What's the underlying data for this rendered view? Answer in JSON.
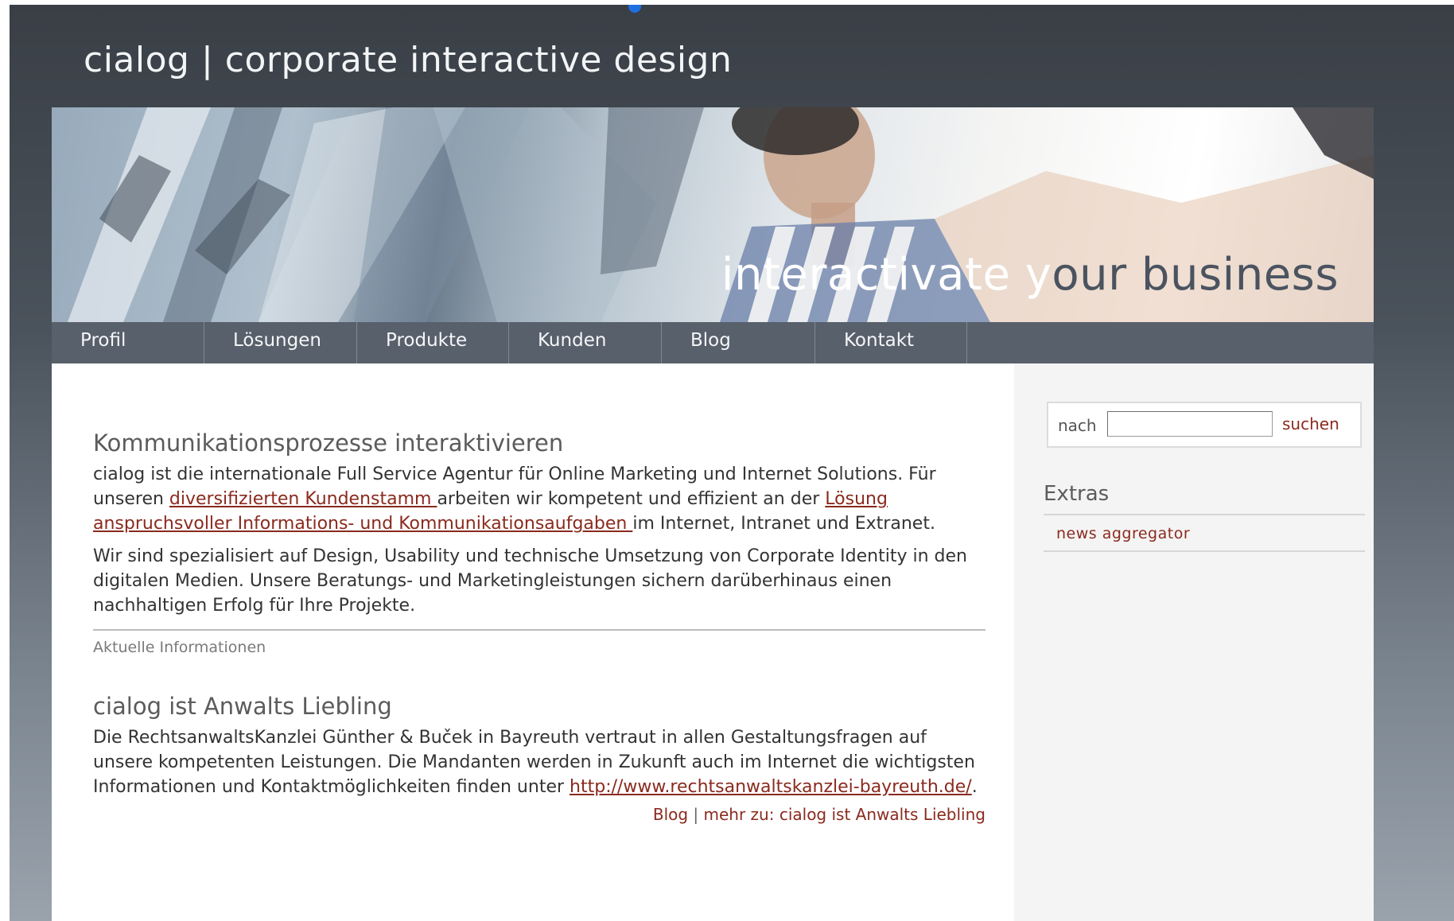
{
  "header": {
    "site_title": "cialog | corporate interactive design"
  },
  "banner": {
    "slogan_part1": "interactivate y",
    "slogan_part2": "our business"
  },
  "nav": {
    "items": [
      {
        "label": "Profil"
      },
      {
        "label": "Lösungen"
      },
      {
        "label": "Produkte"
      },
      {
        "label": "Kunden"
      },
      {
        "label": "Blog"
      },
      {
        "label": "Kontakt"
      }
    ]
  },
  "intro": {
    "heading": "Kommunikationsprozesse interaktivieren",
    "p1_a": "cialog ist die internationale Full Service Agentur für Online Marketing und Internet Solutions. Für unseren ",
    "p1_link1": "diversifizierten Kundenstamm ",
    "p1_b": "arbeiten wir kompetent und effizient an der ",
    "p1_link2": "Lösung anspruchsvoller Informations- und Kommunikationsaufgaben ",
    "p1_c": "im Internet, Intranet und Extranet.",
    "p2": "Wir sind spezialisiert auf Design, Usability und technische Umsetzung von Corporate Identity in den digitalen Medien. Unsere Beratungs- und Marketingleistungen sichern darüberhinaus einen nachhaltigen Erfolg für Ihre Projekte."
  },
  "news": {
    "section_label": "Aktuelle Informationen",
    "article_title": "cialog ist Anwalts Liebling",
    "article_text": "Die RechtsanwaltsKanzlei Günther & Buček in Bayreuth vertraut in allen Gestaltungsfragen auf unsere kompetenten Leistungen. Die Mandanten werden in Zukunft auch im Internet die wichtigsten Informationen und Kontaktmöglichkeiten finden unter ",
    "article_link": "http://www.rechtsanwaltskanzlei-bayreuth.de/",
    "article_end": ".",
    "meta_category": "Blog",
    "meta_sep": " | ",
    "meta_more": "mehr zu: cialog ist Anwalts Liebling"
  },
  "sidebar": {
    "search_label": "nach",
    "search_value": "",
    "search_button": "suchen",
    "extras_title": "Extras",
    "extras_items": [
      {
        "label": "news aggregator"
      }
    ]
  },
  "colors": {
    "link": "#8a2a1e",
    "nav_bg": "#57606b",
    "header_bg": "#3a3f46"
  }
}
